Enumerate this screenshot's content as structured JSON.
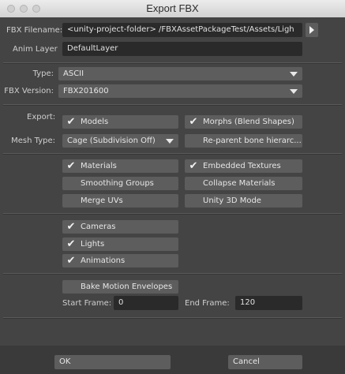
{
  "window": {
    "title": "Export FBX"
  },
  "filename": {
    "label": "FBX Filename:",
    "value": "<unity-project-folder> /FBXAssetPackageTest/Assets/Ligh"
  },
  "anim_layer": {
    "label": "Anim Layer",
    "value": "DefaultLayer"
  },
  "type": {
    "label": "Type:",
    "value": "ASCII"
  },
  "fbx_version": {
    "label": "FBX Version:",
    "value": "FBX201600"
  },
  "export": {
    "label": "Export:",
    "models": {
      "label": "Models",
      "checked": true
    },
    "morphs": {
      "label": "Morphs (Blend Shapes)",
      "checked": true
    }
  },
  "mesh_type": {
    "label": "Mesh Type:",
    "value": "Cage (Subdivision Off)",
    "reparent": {
      "label": "Re-parent bone hierarc...",
      "checked": false
    }
  },
  "materials_group": {
    "materials": {
      "label": "Materials",
      "checked": true
    },
    "embedded_textures": {
      "label": "Embedded Textures",
      "checked": true
    },
    "smoothing_groups": {
      "label": "Smoothing Groups",
      "checked": false
    },
    "collapse_materials": {
      "label": "Collapse Materials",
      "checked": false
    },
    "merge_uvs": {
      "label": "Merge UVs",
      "checked": false
    },
    "unity_3d_mode": {
      "label": "Unity 3D Mode",
      "checked": false
    }
  },
  "scene_group": {
    "cameras": {
      "label": "Cameras",
      "checked": true
    },
    "lights": {
      "label": "Lights",
      "checked": true
    },
    "animations": {
      "label": "Animations",
      "checked": true
    }
  },
  "motion": {
    "bake_motion_envelopes": {
      "label": "Bake Motion Envelopes",
      "checked": false
    },
    "start_frame": {
      "label": "Start Frame:",
      "value": "0"
    },
    "end_frame": {
      "label": "End Frame:",
      "value": "120"
    }
  },
  "buttons": {
    "ok": "OK",
    "cancel": "Cancel"
  },
  "icons": {
    "checkmark": "✔",
    "browse": "play-triangle-icon",
    "dropdown": "chevron-down-icon"
  }
}
